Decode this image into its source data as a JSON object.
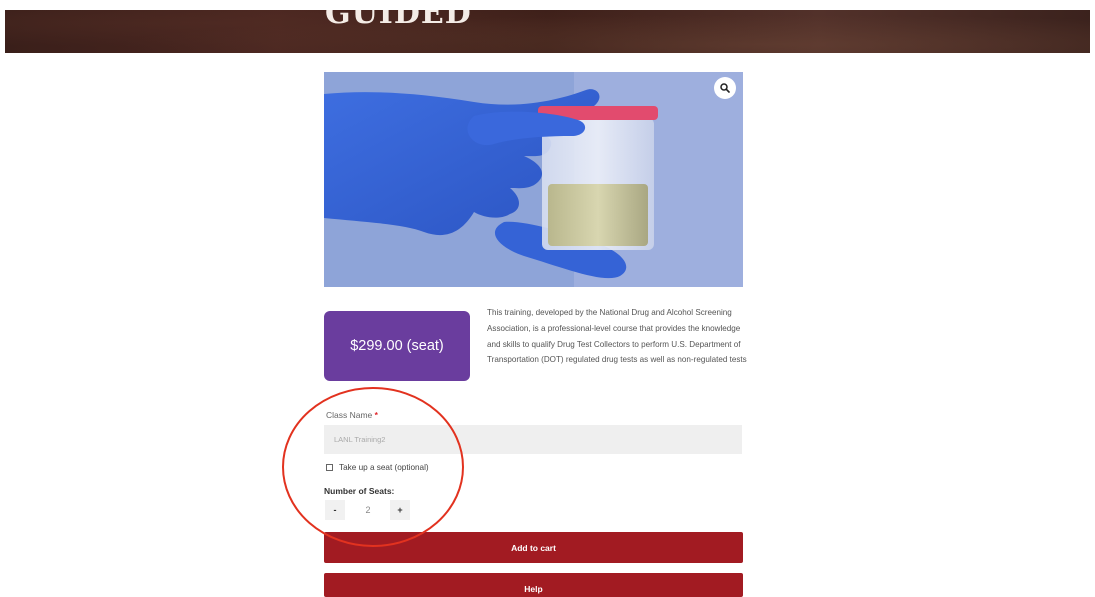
{
  "hero": {
    "title": "GUIDED"
  },
  "product": {
    "image_icon": "zoom-magnifier-icon",
    "price_label": "$299.00 (seat)",
    "description": "This training, developed by the National Drug and Alcohol Screening Association, is a professional-level course that provides the knowledge and skills to qualify Drug Test Collectors to perform U.S. Department of Transportation (DOT) regulated drug tests as well as non-regulated tests"
  },
  "form": {
    "class_name_label": "Class Name",
    "required_mark": "*",
    "class_name_value": "LANL Training2",
    "take_seat_label": "Take up a seat (optional)",
    "seats_label": "Number of Seats:",
    "minus_label": "-",
    "plus_label": "+",
    "seats_value": "2"
  },
  "actions": {
    "add_to_cart_label": "Add to cart",
    "help_label": "Help"
  },
  "colors": {
    "price_bg": "#6a3d9e",
    "button_red": "#a21b22",
    "annotation_circle": "#e2321f"
  }
}
